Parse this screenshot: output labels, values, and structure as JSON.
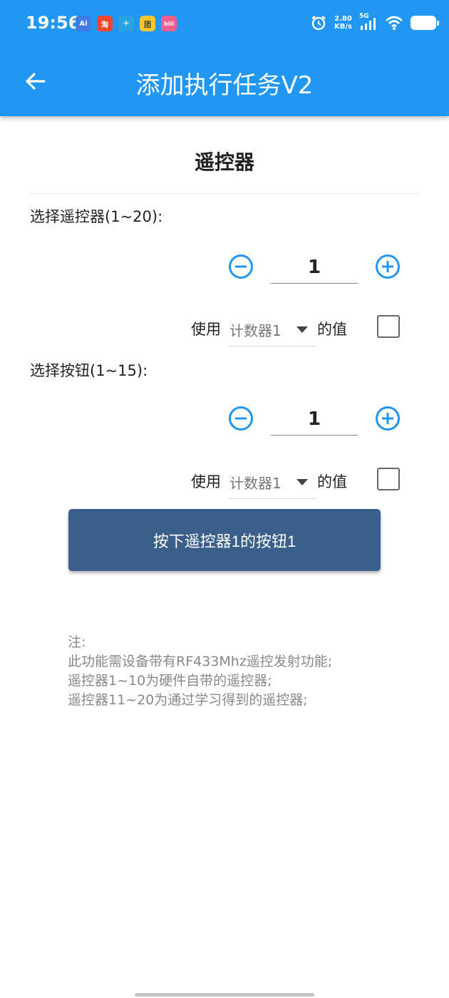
{
  "status_bar": {
    "time": "19:56",
    "app_icons": [
      {
        "icon": "ai-app-icon",
        "text": "Ai",
        "color": "#3F7BE0"
      },
      {
        "icon": "taobao-app-icon",
        "text": "淘",
        "color": "#F2462C"
      },
      {
        "icon": "telegram-app-icon",
        "text": "✈",
        "color": "#2AA3E0"
      },
      {
        "icon": "meituan-app-icon",
        "text": "团",
        "color": "#F7C531"
      },
      {
        "icon": "bilibili-app-icon",
        "text": "bili",
        "color": "#F25D8E"
      }
    ],
    "speed_value": "2.80",
    "speed_unit": "KB/s",
    "network": "5G"
  },
  "header": {
    "title": "添加执行任务V2"
  },
  "main": {
    "section_title": "遥控器",
    "remote": {
      "label": "选择遥控器(1~20):",
      "value": "1",
      "use_prefix": "使用",
      "counter": "计数器1",
      "use_suffix": "的值"
    },
    "button": {
      "label": "选择按钮(1~15):",
      "value": "1",
      "use_prefix": "使用",
      "counter": "计数器1",
      "use_suffix": "的值"
    },
    "action_label": "按下遥控器1的按钮1",
    "note_lines": [
      "注:",
      "此功能需设备带有RF433Mhz遥控发射功能;",
      "遥控器1~10为硬件自带的遥控器;",
      "遥控器11~20为通过学习得到的遥控器;"
    ]
  },
  "colors": {
    "primary": "#2196F3",
    "button": "#3A5F8A",
    "stepper_icon": "#2196F3"
  }
}
